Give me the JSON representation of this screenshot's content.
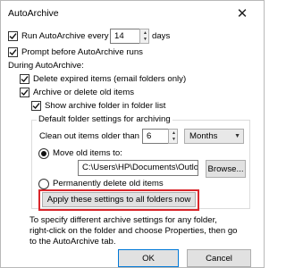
{
  "window": {
    "title": "AutoArchive",
    "close_glyph": "✕"
  },
  "run_every": {
    "label": "Run AutoArchive every",
    "value": "14",
    "unit": "days",
    "checked": true
  },
  "prompt_before": {
    "label": "Prompt before AutoArchive runs",
    "checked": true
  },
  "during_label": "During AutoArchive:",
  "delete_expired": {
    "label": "Delete expired items (email folders only)",
    "checked": true
  },
  "archive_or_delete": {
    "label": "Archive or delete old items",
    "checked": true
  },
  "show_archive_folder": {
    "label": "Show archive folder in folder list",
    "checked": true
  },
  "default_settings": {
    "legend": "Default folder settings for archiving",
    "clean_out_label": "Clean out items older than",
    "clean_out_value": "6",
    "period_selected": "Months",
    "move_old_label": "Move old items to:",
    "move_old_selected": true,
    "path_value": "C:\\Users\\HP\\Documents\\Outlook File",
    "browse_label": "Browse...",
    "permanently_delete_label": "Permanently delete old items",
    "apply_all_label": "Apply these settings to all folders now"
  },
  "footer": {
    "line1": "To specify different archive settings for any folder,",
    "line2": "right-click on the folder and choose Properties, then go",
    "line3": "to the AutoArchive tab."
  },
  "buttons": {
    "ok": "OK",
    "cancel": "Cancel"
  },
  "colors": {
    "highlight": "#d9262b",
    "button_bg": "#e1e1e1",
    "ok_border": "#0078d7"
  },
  "icons": {
    "close": "close-icon",
    "checkbox_check": "checkmark-icon",
    "spinner_up": "chevron-up-icon",
    "spinner_down": "chevron-down-icon",
    "dropdown": "chevron-down-icon",
    "radio_dot": "radio-dot-icon"
  }
}
